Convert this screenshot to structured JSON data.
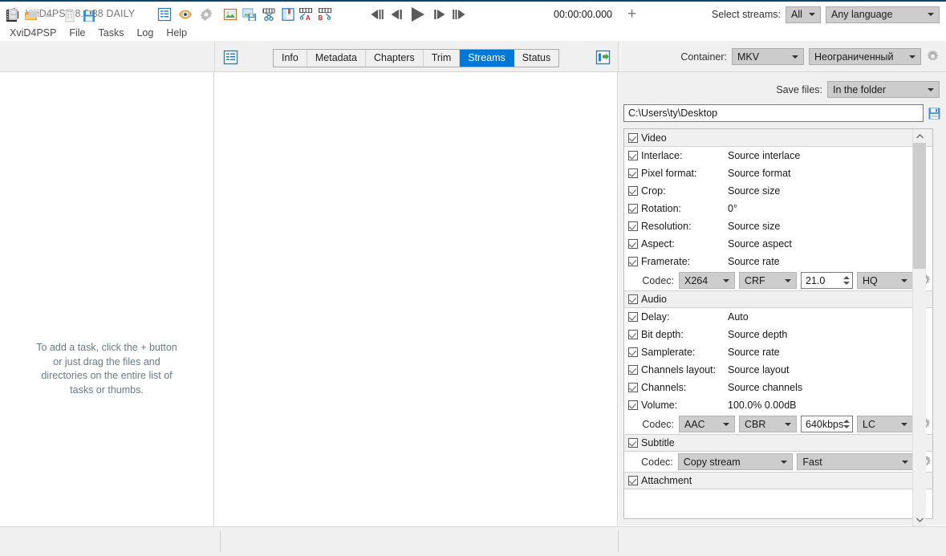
{
  "window": {
    "title": "XviD4PSP 8.0.38 DAILY",
    "app_icon": "film-app-icon",
    "minimize": "minimize-icon",
    "maximize": "maximize-icon",
    "close": "close-icon"
  },
  "menubar": {
    "items": [
      {
        "label": "XviD4PSP"
      },
      {
        "label": "File"
      },
      {
        "label": "Tasks"
      },
      {
        "label": "Log"
      },
      {
        "label": "Help"
      }
    ]
  },
  "toolbar": {
    "icons": [
      {
        "name": "film-strip-icon"
      },
      {
        "name": "open-folder-icon"
      },
      {
        "name": "remove-icon"
      },
      {
        "name": "clipboard-icon"
      },
      {
        "name": "save-icon"
      }
    ],
    "list_view_icon": "list-view-icon",
    "export_icon": "export-arrow-icon",
    "tabs": [
      {
        "label": "Info",
        "active": false
      },
      {
        "label": "Metadata",
        "active": false
      },
      {
        "label": "Chapters",
        "active": false
      },
      {
        "label": "Trim",
        "active": false
      },
      {
        "label": "Streams",
        "active": true
      },
      {
        "label": "Status",
        "active": false
      }
    ],
    "container_label": "Container:",
    "container_value": "MKV",
    "profile_value": "Неограниченный",
    "settings_icon": "gear-icon"
  },
  "task_panel": {
    "empty_message": "To add a task, click the + button\nor just drag the files and\ndirectories on the entire list of\ntasks or thumbs.",
    "empty_lines": [
      "To add a task, click the + button",
      "or just drag the files and",
      "directories on the entire list of",
      "tasks or thumbs."
    ]
  },
  "settings": {
    "save_files_label": "Save files:",
    "save_files_value": "In the folder",
    "output_path": "C:\\Users\\ty\\Desktop",
    "save_path_icon": "save-disk-icon",
    "scrollbar": {
      "up_icon": "chevron-up-icon",
      "down_icon": "chevron-down-icon"
    },
    "groups": [
      {
        "name": "Video",
        "checked": true,
        "icon": "film-strip-icon",
        "rows": [
          {
            "label": "Interlace:",
            "value": "Source interlace",
            "checked": true,
            "icon": "sliders-icon"
          },
          {
            "label": "Pixel format:",
            "value": "Source format",
            "checked": true,
            "icon": "sliders-icon"
          },
          {
            "label": "Crop:",
            "value": "Source size",
            "checked": true,
            "icon": "sliders-icon"
          },
          {
            "label": "Rotation:",
            "value": "0°",
            "checked": true,
            "icon": "sliders-icon"
          },
          {
            "label": "Resolution:",
            "value": "Source size",
            "checked": true,
            "icon": "sliders-icon"
          },
          {
            "label": "Aspect:",
            "value": "Source aspect",
            "checked": true,
            "icon": "sliders-icon"
          },
          {
            "label": "Framerate:",
            "value": "Source rate",
            "checked": true,
            "icon": "sliders-icon"
          }
        ],
        "codec": {
          "label": "Codec:",
          "codec_value": "X264",
          "mode_value": "CRF",
          "quality_value": "21.0",
          "preset_value": "HQ",
          "settings_icon": "gear-icon"
        }
      },
      {
        "name": "Audio",
        "checked": true,
        "icon": "speaker-icon",
        "rows": [
          {
            "label": "Delay:",
            "value": "Auto",
            "checked": true,
            "icon": "sliders-icon"
          },
          {
            "label": "Bit depth:",
            "value": "Source depth",
            "checked": true,
            "icon": "sliders-icon"
          },
          {
            "label": "Samplerate:",
            "value": "Source rate",
            "checked": true,
            "icon": "sliders-icon"
          },
          {
            "label": "Channels layout:",
            "value": "Source layout",
            "checked": true,
            "icon": "sliders-icon"
          },
          {
            "label": "Channels:",
            "value": "Source channels",
            "checked": true,
            "icon": "sliders-icon"
          },
          {
            "label": "Volume:",
            "value": "100.0% 0.00dB",
            "checked": true,
            "icon": "sliders-icon"
          }
        ],
        "codec": {
          "label": "Codec:",
          "codec_value": "AAC",
          "mode_value": "CBR",
          "quality_value": "640kbps",
          "preset_value": "LC",
          "settings_icon": "gear-icon"
        }
      },
      {
        "name": "Subtitle",
        "checked": true,
        "icon": "subtitle-abc-icon",
        "rows": [],
        "codec": {
          "label": "Codec:",
          "codec_value": "Copy stream",
          "preset_value": "Fast",
          "settings_icon": "gear-icon"
        }
      },
      {
        "name": "Attachment",
        "checked": true,
        "icon": "paperclip-icon",
        "rows": []
      }
    ]
  },
  "statusbar": {
    "left_icons": [
      {
        "name": "film-disabled-icon"
      },
      {
        "name": "camera-disabled-icon"
      }
    ],
    "view_icons": [
      {
        "name": "list-view-icon"
      },
      {
        "name": "eye-preview-icon"
      },
      {
        "name": "gear-icon"
      }
    ],
    "edit_icons": [
      {
        "name": "image-icon"
      },
      {
        "name": "save-image-icon"
      },
      {
        "name": "cut-film-icon"
      },
      {
        "name": "bookmark-icon"
      }
    ],
    "trim_icons": [
      {
        "name": "trim-start-a-icon"
      },
      {
        "name": "trim-end-b-icon"
      }
    ],
    "playback": [
      {
        "name": "prev-frame-fast-icon"
      },
      {
        "name": "prev-frame-icon"
      },
      {
        "name": "play-icon"
      },
      {
        "name": "next-frame-icon"
      },
      {
        "name": "next-frame-fast-icon"
      }
    ],
    "timecode": "00:00:00.000",
    "add_button": "+",
    "select_streams_label": "Select streams:",
    "select_streams_value": "All",
    "language_value": "Any language"
  },
  "colors": {
    "accent": "#0078d7",
    "titlebar_accent": "#12436b",
    "panel_bg": "#f0f0f0",
    "combo_bg": "#cccccc",
    "text": "#1a1a1a",
    "muted_text": "#6b7b86"
  }
}
